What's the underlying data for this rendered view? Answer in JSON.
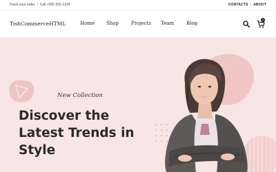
{
  "topbar": {
    "track_order": "Track your order",
    "call": "Call +555 555-1234",
    "contacts": "CONTACTS",
    "about": "ABOUT"
  },
  "nav": {
    "logo": "TishCommerceHTML",
    "items": [
      {
        "label": "Home"
      },
      {
        "label": "Shop"
      },
      {
        "label": "Projects"
      },
      {
        "label": "Team"
      },
      {
        "label": "Blog"
      }
    ],
    "cart_count": "0",
    "icons": [
      "search-icon",
      "cart-icon"
    ]
  },
  "hero": {
    "subtitle": "New Collection",
    "headline_lines": [
      "Discover the",
      "Latest Trends in",
      "Style"
    ],
    "background_color": "#f7e6e4",
    "blob_color": "#f0c9c6"
  }
}
